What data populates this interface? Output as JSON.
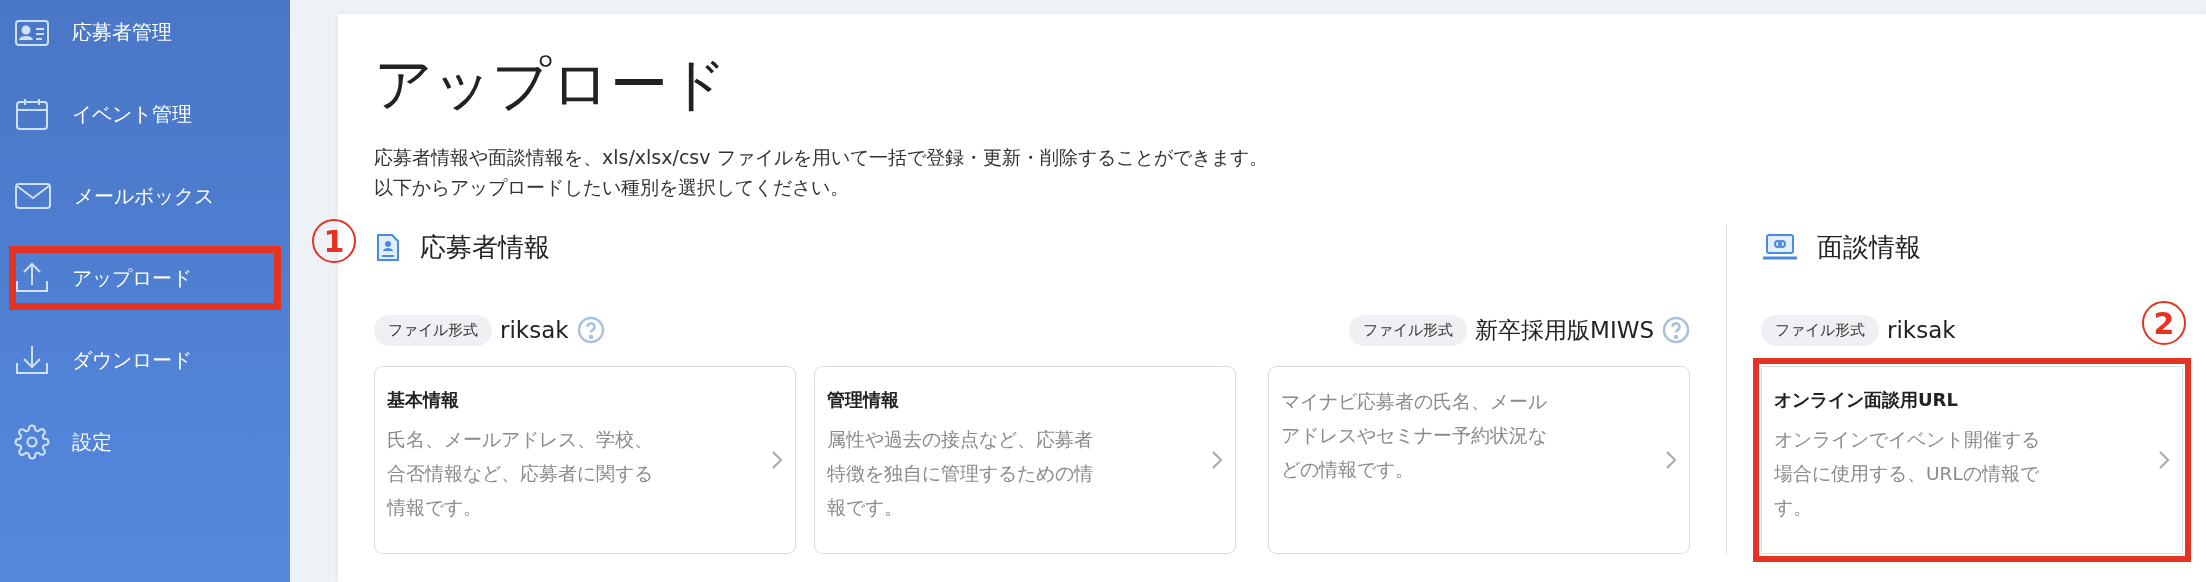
{
  "sidebar": {
    "items": [
      {
        "label": "応募者管理",
        "highlighted": false
      },
      {
        "label": "イベント管理",
        "highlighted": false
      },
      {
        "label": "メールボックス",
        "highlighted": false
      },
      {
        "label": "アップロード",
        "highlighted": true,
        "marker": "1"
      },
      {
        "label": "ダウンロード",
        "highlighted": false
      },
      {
        "label": "設定",
        "highlighted": false
      }
    ]
  },
  "page": {
    "title": "アップロード",
    "description": [
      "応募者情報や面談情報を、xls/xlsx/csv ファイルを用いて一括で登録・更新・削除することができます。",
      "以下からアップロードしたい種別を選択してください。"
    ]
  },
  "sections": [
    {
      "title": "応募者情報",
      "groups": [
        {
          "format_label": "ファイル形式",
          "format": "riksak",
          "help": true,
          "cards": [
            {
              "title": "基本情報",
              "description": "氏名、メールアドレス、学校、合否情報など、応募者に関する情報です。",
              "highlighted": false
            },
            {
              "title": "管理情報",
              "description": "属性や過去の接点など、応募者特徴を独自に管理するための情報です。",
              "highlighted": false
            }
          ]
        },
        {
          "format_label": "ファイル形式",
          "format": "新卒採用版MIWS",
          "help": true,
          "cards": [
            {
              "description": "マイナビ応募者の氏名、メールアドレスやセミナー予約状況などの情報です。",
              "highlighted": false
            }
          ]
        }
      ]
    },
    {
      "title": "面談情報",
      "groups": [
        {
          "format_label": "ファイル形式",
          "format": "riksak",
          "help": false,
          "cards": [
            {
              "title": "オンライン面談用URL",
              "description": "オンラインでイベント開催する場合に使用する、URLの情報です。",
              "highlighted": true,
              "marker": "2"
            }
          ]
        }
      ]
    }
  ]
}
